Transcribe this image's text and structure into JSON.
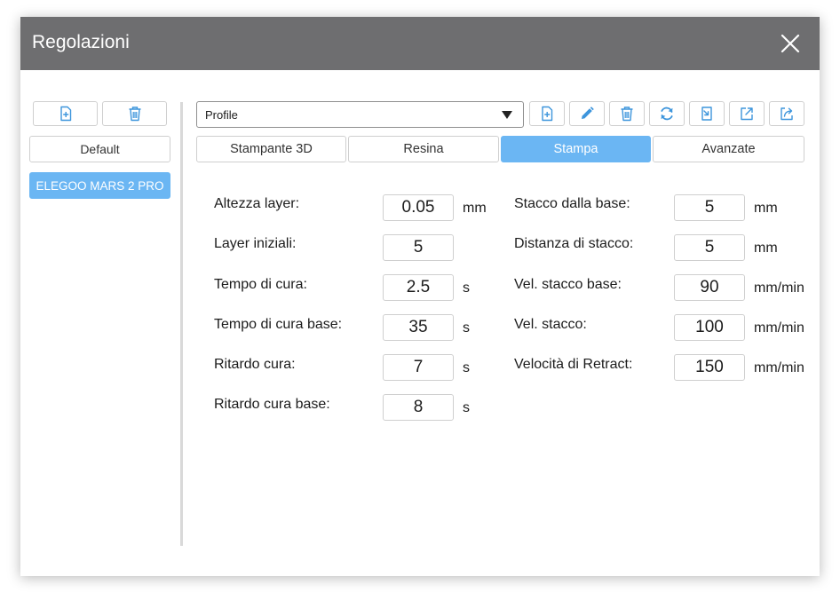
{
  "window": {
    "title": "Regolazioni"
  },
  "sidebar": {
    "profiles": [
      "Default",
      "ELEGOO MARS 2 PRO"
    ]
  },
  "toolbar": {
    "profile_select": {
      "value": "Profile"
    }
  },
  "tabs": [
    {
      "label": "Stampante 3D"
    },
    {
      "label": "Resina"
    },
    {
      "label": "Stampa"
    },
    {
      "label": "Avanzate"
    }
  ],
  "active_tab": "Stampa",
  "settings": {
    "left": [
      {
        "label": "Altezza layer:",
        "value": "0.05",
        "unit": "mm"
      },
      {
        "label": "Layer iniziali:",
        "value": "5",
        "unit": ""
      },
      {
        "label": "Tempo di cura:",
        "value": "2.5",
        "unit": "s"
      },
      {
        "label": "Tempo di cura base:",
        "value": "35",
        "unit": "s"
      },
      {
        "label": "Ritardo cura:",
        "value": "7",
        "unit": "s"
      },
      {
        "label": "Ritardo cura base:",
        "value": "8",
        "unit": "s"
      }
    ],
    "right": [
      {
        "label": "Stacco dalla base:",
        "value": "5",
        "unit": "mm"
      },
      {
        "label": "Distanza di stacco:",
        "value": "5",
        "unit": "mm"
      },
      {
        "label": "Vel. stacco base:",
        "value": "90",
        "unit": "mm/min"
      },
      {
        "label": "Vel. stacco:",
        "value": "100",
        "unit": "mm/min"
      },
      {
        "label": "Velocità di Retract:",
        "value": "150",
        "unit": "mm/min"
      }
    ]
  },
  "colors": {
    "titlebar": "#6e6e70",
    "accent": "#6bb6f3",
    "icon": "#3d95dc"
  },
  "icons": {
    "sidebar_add": "file-add-icon",
    "sidebar_delete": "trash-icon",
    "toolbar": [
      "file-add-icon",
      "pencil-icon",
      "trash-icon",
      "refresh-icon",
      "import-icon",
      "export-icon",
      "share-icon"
    ],
    "close": "close-icon"
  }
}
